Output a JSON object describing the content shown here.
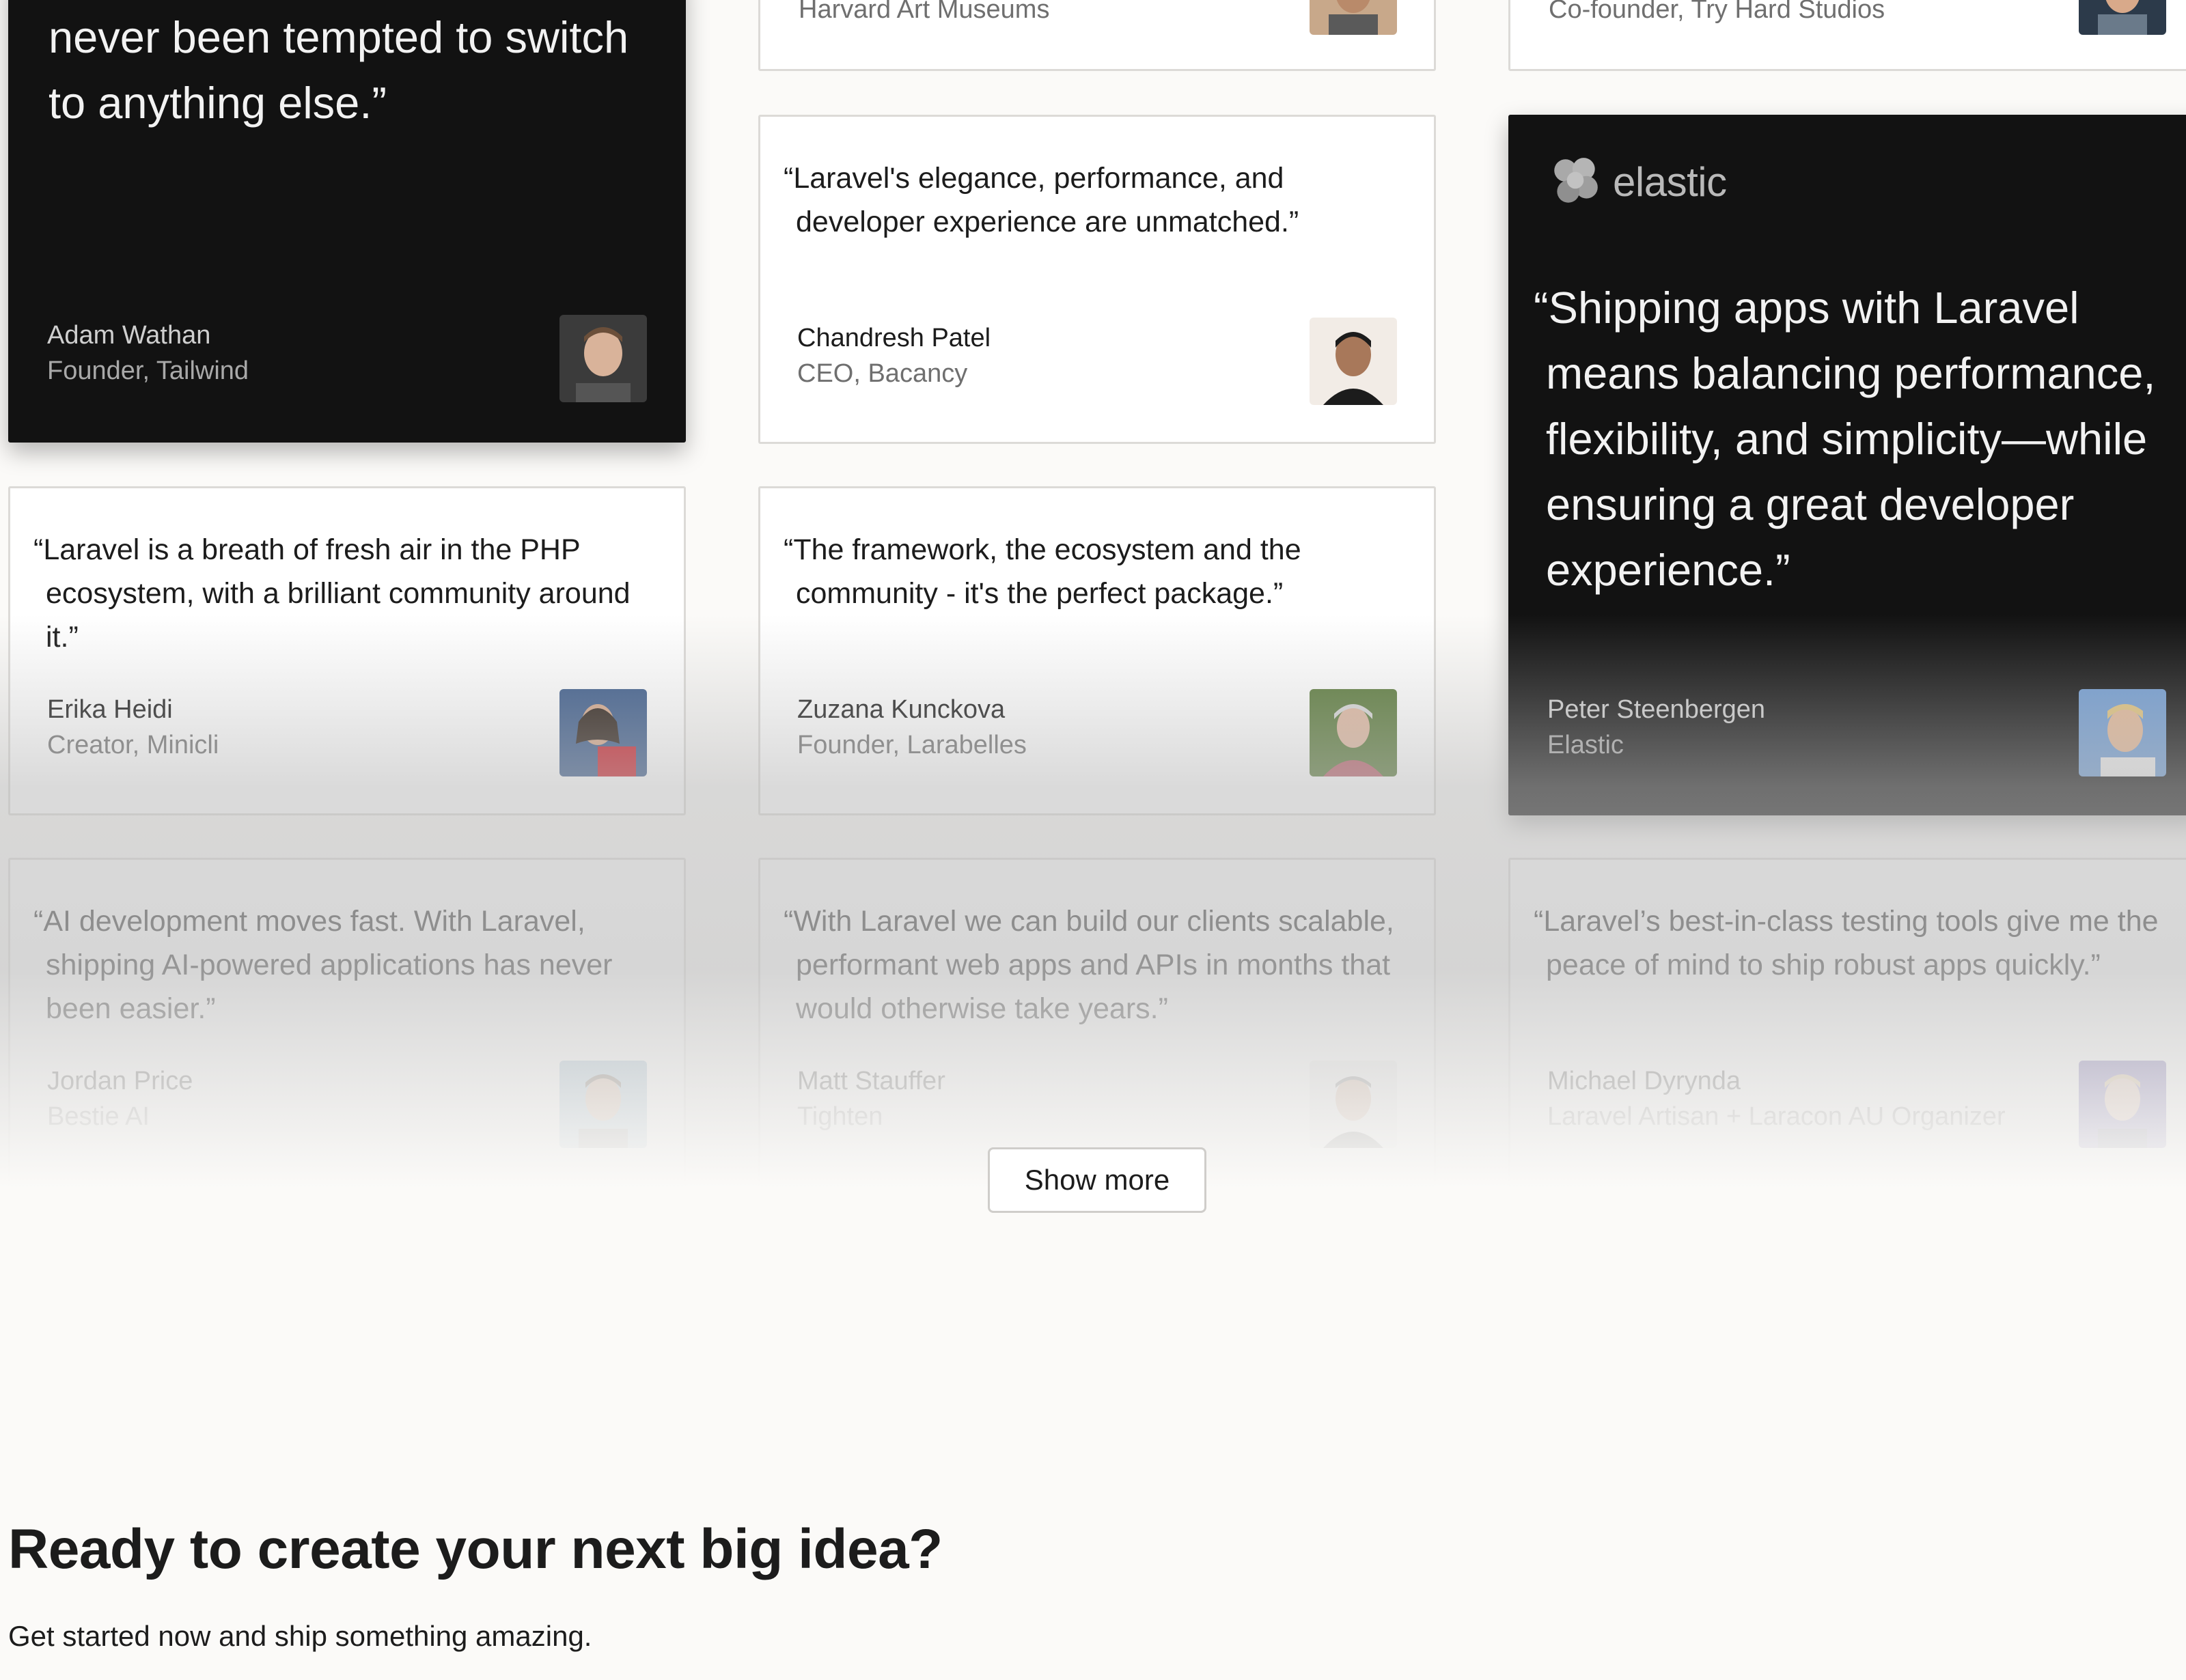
{
  "testimonials": {
    "top_left": {
      "quote_tail": "never been tempted to switch to anything else.”",
      "name": "Adam Wathan",
      "role": "Founder, Tailwind"
    },
    "top_mid_partial": {
      "role": "Harvard Art Museums"
    },
    "top_right_partial": {
      "role": "Co-founder, Try Hard Studios"
    },
    "chandresh": {
      "quote": "“Laravel's elegance, performance, and developer experience are unmatched.”",
      "name": "Chandresh Patel",
      "role": "CEO, Bacancy"
    },
    "elastic": {
      "logo_text": "elastic",
      "quote": "“Shipping apps with Laravel means balancing performance, flexibility, and simplicity—while ensuring a great developer experience.”",
      "name": "Peter Steenbergen",
      "role": "Elastic"
    },
    "erika": {
      "quote": "“Laravel is a breath of fresh air in the PHP ecosystem, with a brilliant community around it.”",
      "name": "Erika Heidi",
      "role": "Creator, Minicli"
    },
    "zuzana": {
      "quote": "“The framework, the ecosystem and the community - it's the perfect package.”",
      "name": "Zuzana Kunckova",
      "role": "Founder, Larabelles"
    },
    "jordan": {
      "quote": "“AI development moves fast. With Laravel, shipping AI-powered applications has never been easier.”",
      "name": "Jordan Price",
      "role": "Bestie AI"
    },
    "matt": {
      "quote": "“With Laravel we can build our clients scalable, performant web apps and APIs in months that would otherwise take years.”",
      "name": "Matt Stauffer",
      "role": "Tighten"
    },
    "michael": {
      "quote": "“Laravel’s best-in-class testing tools give me the peace of mind to ship robust apps quickly.”",
      "name": "Michael Dyrynda",
      "role": "Laravel Artisan + Laracon AU Organizer"
    }
  },
  "show_more_label": "Show more",
  "cta": {
    "title": "Ready to create your next big idea?",
    "subtitle": "Get started now and ship something amazing."
  }
}
